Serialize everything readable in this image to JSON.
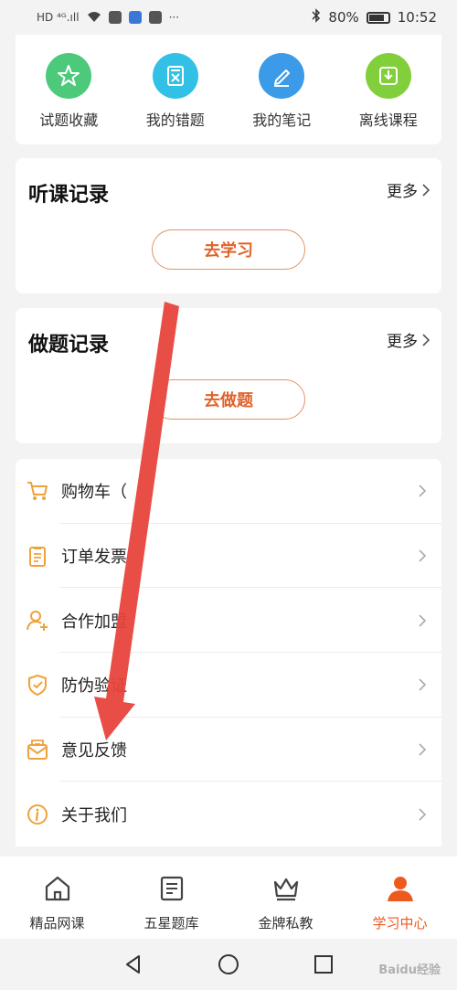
{
  "status_bar": {
    "left_text": "HD ⁴ᴳ.ıll",
    "battery": "80%",
    "time": "10:52"
  },
  "quick_actions": [
    {
      "label": "试题收藏",
      "icon": "star-icon",
      "color": "#4cc97b"
    },
    {
      "label": "我的错题",
      "icon": "wrong-book-icon",
      "color": "#32c0e6"
    },
    {
      "label": "我的笔记",
      "icon": "pencil-icon",
      "color": "#3b9be8"
    },
    {
      "label": "离线课程",
      "icon": "download-icon",
      "color": "#82cf3c"
    }
  ],
  "listen_record": {
    "title": "听课记录",
    "more": "更多",
    "button": "去学习"
  },
  "exercise_record": {
    "title": "做题记录",
    "more": "更多",
    "button": "去做题"
  },
  "menu": [
    {
      "label": "购物车（",
      "icon": "cart-icon"
    },
    {
      "label": "订单发票",
      "icon": "clipboard-icon"
    },
    {
      "label": "合作加盟",
      "icon": "user-add-icon"
    },
    {
      "label": "防伪验证",
      "icon": "shield-check-icon"
    },
    {
      "label": "意见反馈",
      "icon": "envelope-icon"
    },
    {
      "label": "关于我们",
      "icon": "info-icon"
    }
  ],
  "tabs": [
    {
      "label": "精品网课",
      "icon": "home-icon"
    },
    {
      "label": "五星题库",
      "icon": "book-icon"
    },
    {
      "label": "金牌私教",
      "icon": "crown-icon"
    },
    {
      "label": "学习中心",
      "icon": "person-icon",
      "active": true
    }
  ],
  "watermark": "Baidu经验",
  "colors": {
    "accent": "#ee5a1e",
    "icon_orange": "#f0a23a",
    "arrow_red": "#e8453c"
  }
}
